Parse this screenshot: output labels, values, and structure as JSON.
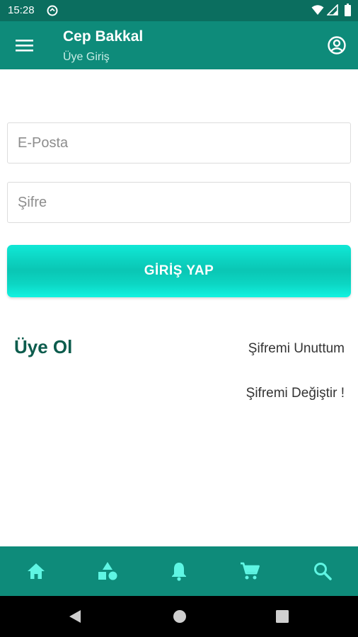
{
  "status_bar": {
    "time": "15:28",
    "icons": [
      "sync-icon",
      "wifi-icon",
      "signal-icon",
      "battery-icon"
    ]
  },
  "app_bar": {
    "title": "Cep Bakkal",
    "subtitle": "Üye Giriş",
    "left_icon": "menu-icon",
    "right_icon": "account-icon"
  },
  "form": {
    "email_placeholder": "E-Posta",
    "email_value": "",
    "password_placeholder": "Şifre",
    "password_value": "",
    "login_label": "GİRİŞ YAP"
  },
  "links": {
    "register": "Üye Ol",
    "forgot_password": "Şifremi Unuttum",
    "change_password": "Şifremi Değiştir !"
  },
  "bottom_nav": [
    "home-icon",
    "categories-icon",
    "notifications-icon",
    "cart-icon",
    "search-icon"
  ],
  "system_nav": [
    "back-icon",
    "home-circle-icon",
    "recents-icon"
  ],
  "colors": {
    "status_bar": "#0b6e5f",
    "primary": "#0e8b7a",
    "accent": "#10e8d6",
    "nav_icon": "#5ff5e3",
    "register_text": "#0d5c4d"
  }
}
